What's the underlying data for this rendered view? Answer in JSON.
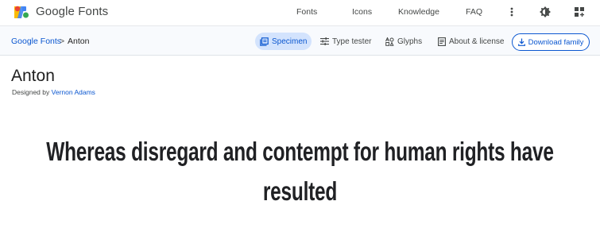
{
  "header": {
    "brand": "Google Fonts",
    "nav": [
      {
        "label": "Fonts"
      },
      {
        "label": "Icons"
      },
      {
        "label": "Knowledge"
      },
      {
        "label": "FAQ"
      }
    ],
    "icons": [
      "more-vert-icon",
      "theme-toggle-icon",
      "apps-grid-icon"
    ]
  },
  "subbar": {
    "breadcrumb": {
      "root": "Google Fonts",
      "separator": ">",
      "current": "Anton"
    },
    "tabs": [
      {
        "label": "Specimen",
        "icon": "specimen-icon",
        "active": true
      },
      {
        "label": "Type tester",
        "icon": "type-tester-icon",
        "active": false
      },
      {
        "label": "Glyphs",
        "icon": "glyphs-icon",
        "active": false
      },
      {
        "label": "About & license",
        "icon": "about-icon",
        "active": false
      }
    ],
    "download_label": "Download family"
  },
  "main": {
    "font_name": "Anton",
    "designed_by_prefix": "Designed by",
    "designer": "Vernon Adams",
    "specimen_text": "Whereas disregard and contempt for human rights have resulted"
  },
  "colors": {
    "accent": "#0b57d0",
    "active_tab_bg": "#d3e3fd",
    "subbar_bg": "#f8fafd",
    "text": "#1f1f1f"
  }
}
